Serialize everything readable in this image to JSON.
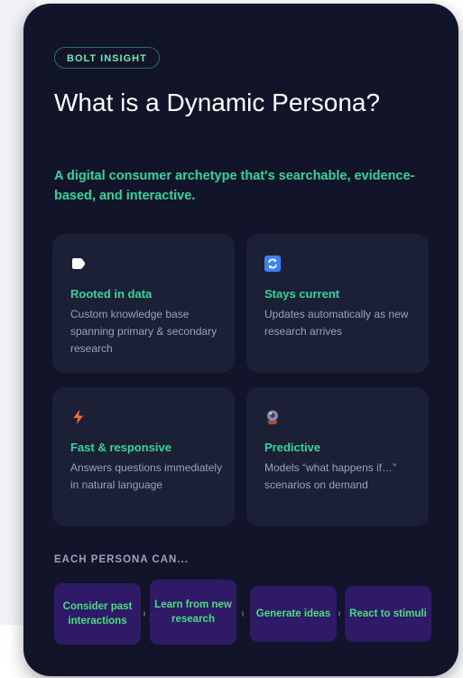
{
  "badge": "BOLT INSIGHT",
  "title": "What is a Dynamic Persona?",
  "subtitle": "A digital consumer archetype that's searchable, evidence-based, and interactive.",
  "features": [
    {
      "icon": "tag-icon",
      "heading": "Rooted in data",
      "description": "Custom knowledge base spanning primary & secondary research"
    },
    {
      "icon": "refresh-icon",
      "heading": "Stays current",
      "description": "Updates automatically as new research arrives"
    },
    {
      "icon": "lightning-icon",
      "heading": "Fast & responsive",
      "description": "Answers questions immediately in natural language"
    },
    {
      "icon": "crystal-ball-icon",
      "heading": "Predictive",
      "description": "Models “what happens if…” scenarios on demand"
    }
  ],
  "capabilities_label": "EACH PERSONA CAN...",
  "capabilities": [
    "Consider past interactions",
    "Learn from new research",
    "Generate ideas",
    "React to stimuli"
  ],
  "colors": {
    "card_background": "#12152a",
    "tile_background": "#1c2036",
    "accent_green": "#34d399",
    "pill_background": "#2e1a66",
    "lightning_orange": "#f97316",
    "refresh_blue": "#3b82f6"
  }
}
